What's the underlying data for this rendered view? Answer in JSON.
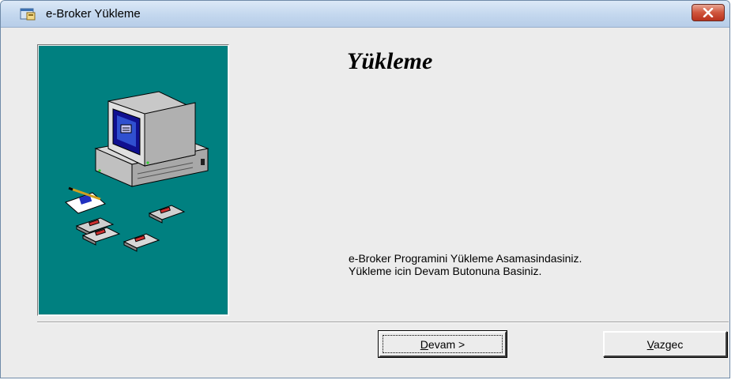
{
  "window": {
    "title": "e-Broker Yükleme"
  },
  "content": {
    "heading": "Yükleme",
    "message_lines": [
      "e-Broker Programini Yükleme Asamasindasiniz.",
      "Yükleme icin Devam Butonuna Basiniz."
    ]
  },
  "buttons": {
    "continue": {
      "mnemonic": "D",
      "rest": "evam >"
    },
    "cancel": {
      "mnemonic": "V",
      "rest": "azgec"
    }
  },
  "icons": {
    "app": "setup-window-icon",
    "close": "close-icon",
    "illustration": "computer-with-floppy-disks-illustration"
  },
  "colors": {
    "panel_background": "#008080",
    "window_background": "#ececec",
    "close_button": "#c9462f"
  }
}
